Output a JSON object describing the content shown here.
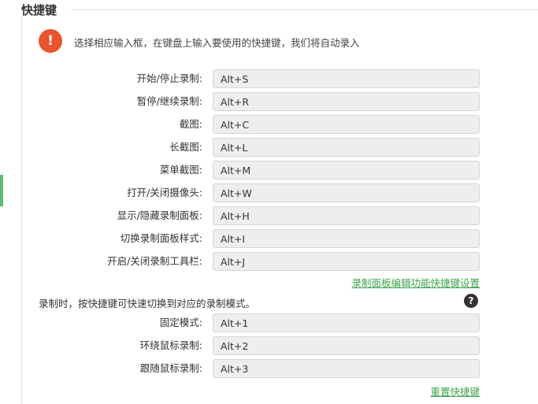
{
  "section": {
    "title": "快捷键"
  },
  "notice": {
    "icon": "exclamation-icon",
    "text": "选择相应输入框，在键盘上输入要使用的快捷键，我们将自动录入"
  },
  "shortcuts": [
    {
      "label": "开始/停止录制:",
      "value": "Alt+S"
    },
    {
      "label": "暂停/继续录制:",
      "value": "Alt+R"
    },
    {
      "label": "截图:",
      "value": "Alt+C"
    },
    {
      "label": "长截图:",
      "value": "Alt+L"
    },
    {
      "label": "菜单截图:",
      "value": "Alt+M"
    },
    {
      "label": "打开/关闭摄像头:",
      "value": "Alt+W"
    },
    {
      "label": "显示/隐藏录制面板:",
      "value": "Alt+H"
    },
    {
      "label": "切换录制面板样式:",
      "value": "Alt+I"
    },
    {
      "label": "开启/关闭录制工具栏:",
      "value": "Alt+J"
    }
  ],
  "panel_link": "录制面板编辑功能快捷键设置",
  "modes": {
    "description": "录制时，按快捷键可快速切换到对应的录制模式。",
    "help_icon": "question-icon",
    "items": [
      {
        "label": "固定模式:",
        "value": "Alt+1"
      },
      {
        "label": "环绕鼠标录制:",
        "value": "Alt+2"
      },
      {
        "label": "跟随鼠标录制:",
        "value": "Alt+3"
      }
    ]
  },
  "reset_link": "重置快捷键",
  "colors": {
    "accent": "#3fa34d",
    "alert": "#e9542e",
    "sidebar_marker": "#5bbd72"
  }
}
